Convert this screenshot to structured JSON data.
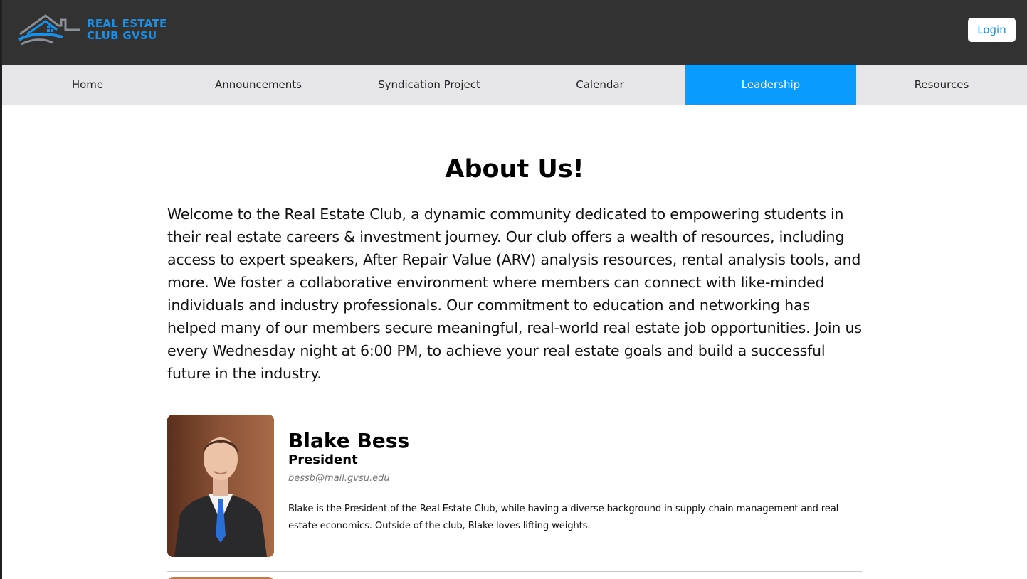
{
  "brand": {
    "logo_text_line1": "REAL ESTATE",
    "logo_text_line2": "CLUB GVSU",
    "accent_color": "#1f8ee0"
  },
  "header": {
    "login_label": "Login"
  },
  "nav": {
    "items": [
      {
        "label": "Home",
        "active": false
      },
      {
        "label": "Announcements",
        "active": false
      },
      {
        "label": "Syndication Project",
        "active": false
      },
      {
        "label": "Calendar",
        "active": false
      },
      {
        "label": "Leadership",
        "active": true
      },
      {
        "label": "Resources",
        "active": false
      }
    ],
    "active_color": "#0a9bff"
  },
  "main": {
    "title": "About Us!",
    "intro": "Welcome to the Real Estate Club, a dynamic community dedicated to empowering students in their real estate careers & investment journey. Our club offers a wealth of resources, including access to expert speakers, After Repair Value (ARV) analysis resources, rental analysis tools, and more. We foster a collaborative environment where members can connect with like-minded individuals and industry professionals. Our commitment to education and networking has helped many of our members secure meaningful, real-world real estate job opportunities. Join us every Wednesday night at 6:00 PM, to achieve your real estate goals and build a successful future in the industry.",
    "members": [
      {
        "name": "Blake Bess",
        "role": "President",
        "email": "bessb@mail.gvsu.edu",
        "bio": "Blake is the President of the Real Estate Club, while having a diverse background in supply chain management and real estate economics. Outside of the club, Blake loves lifting weights."
      }
    ]
  }
}
